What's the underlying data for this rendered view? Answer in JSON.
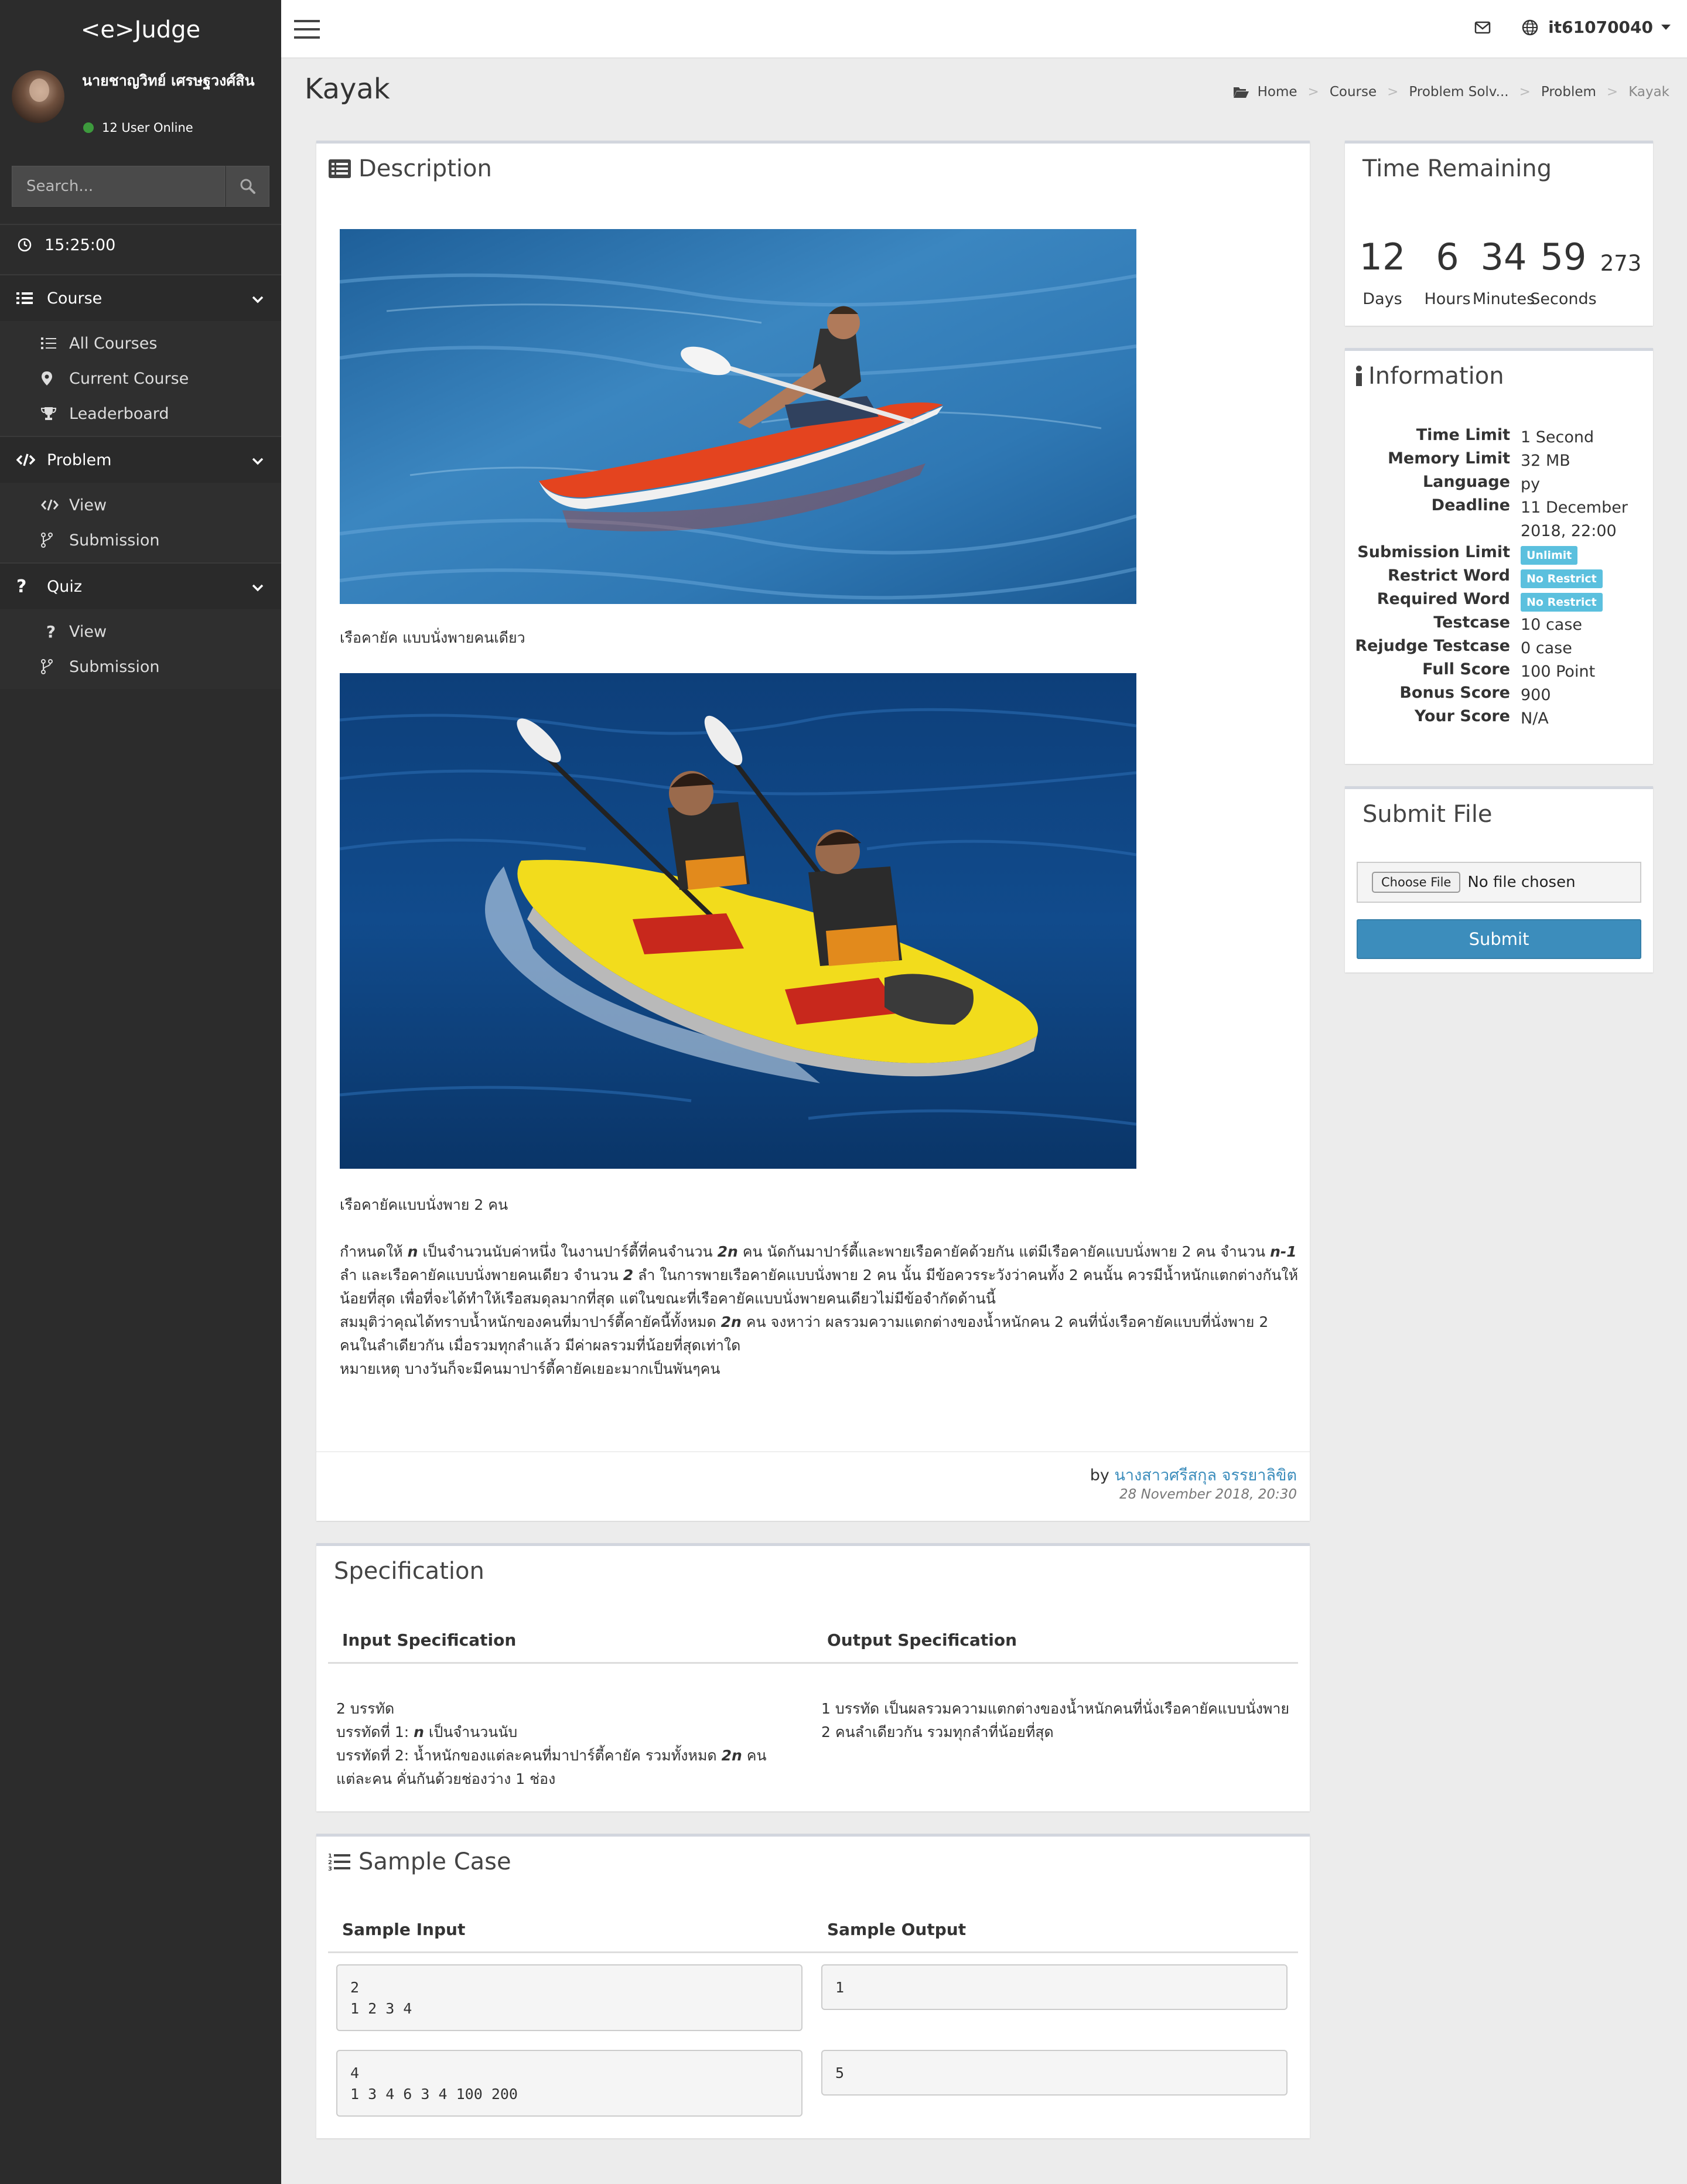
{
  "brand": "<e>Judge",
  "user": {
    "name": "นายชาญวิทย์ เศรษฐวงศ์สิน",
    "online": "12 User Online"
  },
  "search": {
    "placeholder": "Search..."
  },
  "clock": "15:25:00",
  "sidebar": {
    "course": {
      "label": "Course",
      "items": [
        {
          "label": "All Courses",
          "icon": "list-icon"
        },
        {
          "label": "Current Course",
          "icon": "map-marker-icon"
        },
        {
          "label": "Leaderboard",
          "icon": "trophy-icon"
        }
      ]
    },
    "problem": {
      "label": "Problem",
      "items": [
        {
          "label": "View",
          "icon": "code-icon"
        },
        {
          "label": "Submission",
          "icon": "code-fork-icon"
        }
      ]
    },
    "quiz": {
      "label": "Quiz",
      "items": [
        {
          "label": "View",
          "icon": "question-icon"
        },
        {
          "label": "Submission",
          "icon": "code-fork-icon"
        }
      ]
    }
  },
  "topbar": {
    "username": "it61070040"
  },
  "page": {
    "title": "Kayak"
  },
  "breadcrumb": [
    "Home",
    "Course",
    "Problem Solv...",
    "Problem",
    "Kayak"
  ],
  "description": {
    "title": "Description",
    "caption1": "เรือคายัค แบบนั่งพายคนเดียว",
    "caption2": "เรือคายัคแบบนั่งพาย 2 คน",
    "para1": [
      {
        "t": "กำหนดให้ "
      },
      {
        "t": "n",
        "b": true
      },
      {
        "t": " เป็นจำนวนนับค่าหนึ่ง ในงานปาร์ตี้ที่คนจำนวน "
      },
      {
        "t": "2n",
        "b": true
      },
      {
        "t": " คน นัดกันมาปาร์ตี้และพายเรือคายัคด้วยกัน แต่มีเรือคายัคแบบนั่งพาย 2 คน จำนวน "
      },
      {
        "t": "n-1",
        "b": true
      },
      {
        "t": " ลำ และเรือคายัคแบบนั่งพายคนเดียว จำนวน "
      },
      {
        "t": "2",
        "b": true
      },
      {
        "t": " ลำ ในการพายเรือคายัคแบบนั่งพาย 2 คน นั้น มีข้อควรระวังว่าคนทั้ง 2 คนนั้น ควรมีน้ำหนักแตกต่างกันให้น้อยที่สุด เพื่อที่จะได้ทำให้เรือสมดุลมากที่สุด แต่ในขณะที่เรือคายัคแบบนั่งพายคนเดียวไม่มีข้อจำกัดด้านนี้"
      }
    ],
    "para2": [
      {
        "t": "สมมุติว่าคุณได้ทราบน้ำหนักของคนที่มาปาร์ตี้คายัคนี้ทั้งหมด "
      },
      {
        "t": "2n",
        "b": true
      },
      {
        "t": " คน จงหาว่า ผลรวมความแตกต่างของน้ำหนักคน 2 คนที่นั่งเรือคายัคแบบที่นั่งพาย 2 คนในลำเดียวกัน เมื่อรวมทุกลำแล้ว มีค่าผลรวมที่น้อยที่สุดเท่าใด"
      }
    ],
    "para3": "หมายเหตุ บางวันก็จะมีคนมาปาร์ตี้คายัคเยอะมากเป็นพันๆคน",
    "by_prefix": "by",
    "author": "นางสาวศรีสกุล จรรยาลิขิต",
    "date": "28 November 2018, 20:30"
  },
  "specification": {
    "title": "Specification",
    "input_header": "Input Specification",
    "output_header": "Output Specification",
    "input_lines": [
      [
        {
          "t": "2 บรรทัด"
        }
      ],
      [
        {
          "t": "บรรทัดที่ 1: "
        },
        {
          "t": "n",
          "b": true
        },
        {
          "t": " เป็นจำนวนนับ"
        }
      ],
      [
        {
          "t": "บรรทัดที่ 2: น้ำหนักของแต่ละคนที่มาปาร์ตี้คายัค รวมทั้งหมด "
        },
        {
          "t": "2n",
          "b": true
        },
        {
          "t": " คน"
        }
      ],
      [
        {
          "t": "แต่ละคน คั่นกันด้วยช่องว่าง 1 ช่อง"
        }
      ]
    ],
    "output_text": "1 บรรทัด เป็นผลรวมความแตกต่างของน้ำหนักคนที่นั่งเรือคายัคแบบนั่งพาย 2 คนลำเดียวกัน รวมทุกลำที่น้อยที่สุด"
  },
  "sample": {
    "title": "Sample Case",
    "input_header": "Sample Input",
    "output_header": "Sample Output",
    "cases": [
      {
        "input": "2\n1 2 3 4",
        "output": "1"
      },
      {
        "input": "4\n1 3 4 6 3 4 100 200",
        "output": "5"
      }
    ]
  },
  "time_remaining": {
    "title": "Time Remaining",
    "days": "12",
    "hours": "6",
    "minutes": "34",
    "seconds": "59",
    "extra": "273",
    "days_label": "Days",
    "hours_label": "Hours",
    "minutes_label": "Minutes",
    "seconds_label": "Seconds"
  },
  "information": {
    "title": "Information",
    "rows": [
      {
        "key": "Time Limit",
        "value": "1 Second"
      },
      {
        "key": "Memory Limit",
        "value": "32 MB"
      },
      {
        "key": "Language",
        "value": "py"
      },
      {
        "key": "Deadline",
        "value": "11 December 2018, 22:00"
      },
      {
        "key": "Submission Limit",
        "badge": "Unlimit"
      },
      {
        "key": "Restrict Word",
        "badge": "No Restrict"
      },
      {
        "key": "Required Word",
        "badge": "No Restrict"
      },
      {
        "key": "Testcase",
        "value": "10 case"
      },
      {
        "key": "Rejudge Testcase",
        "value": "0 case"
      },
      {
        "key": "Full Score",
        "value": "100 Point"
      },
      {
        "key": "Bonus Score",
        "value": "900"
      },
      {
        "key": "Your Score",
        "value": "N/A"
      }
    ]
  },
  "submit": {
    "title": "Submit File",
    "choose_label": "Choose File",
    "no_file": "No file chosen",
    "button": "Submit"
  },
  "colors": {
    "sidebar": "#2c2c2c",
    "accent": "#3c8dbc",
    "badge": "#5bc0de",
    "online": "#3d9a3d"
  }
}
